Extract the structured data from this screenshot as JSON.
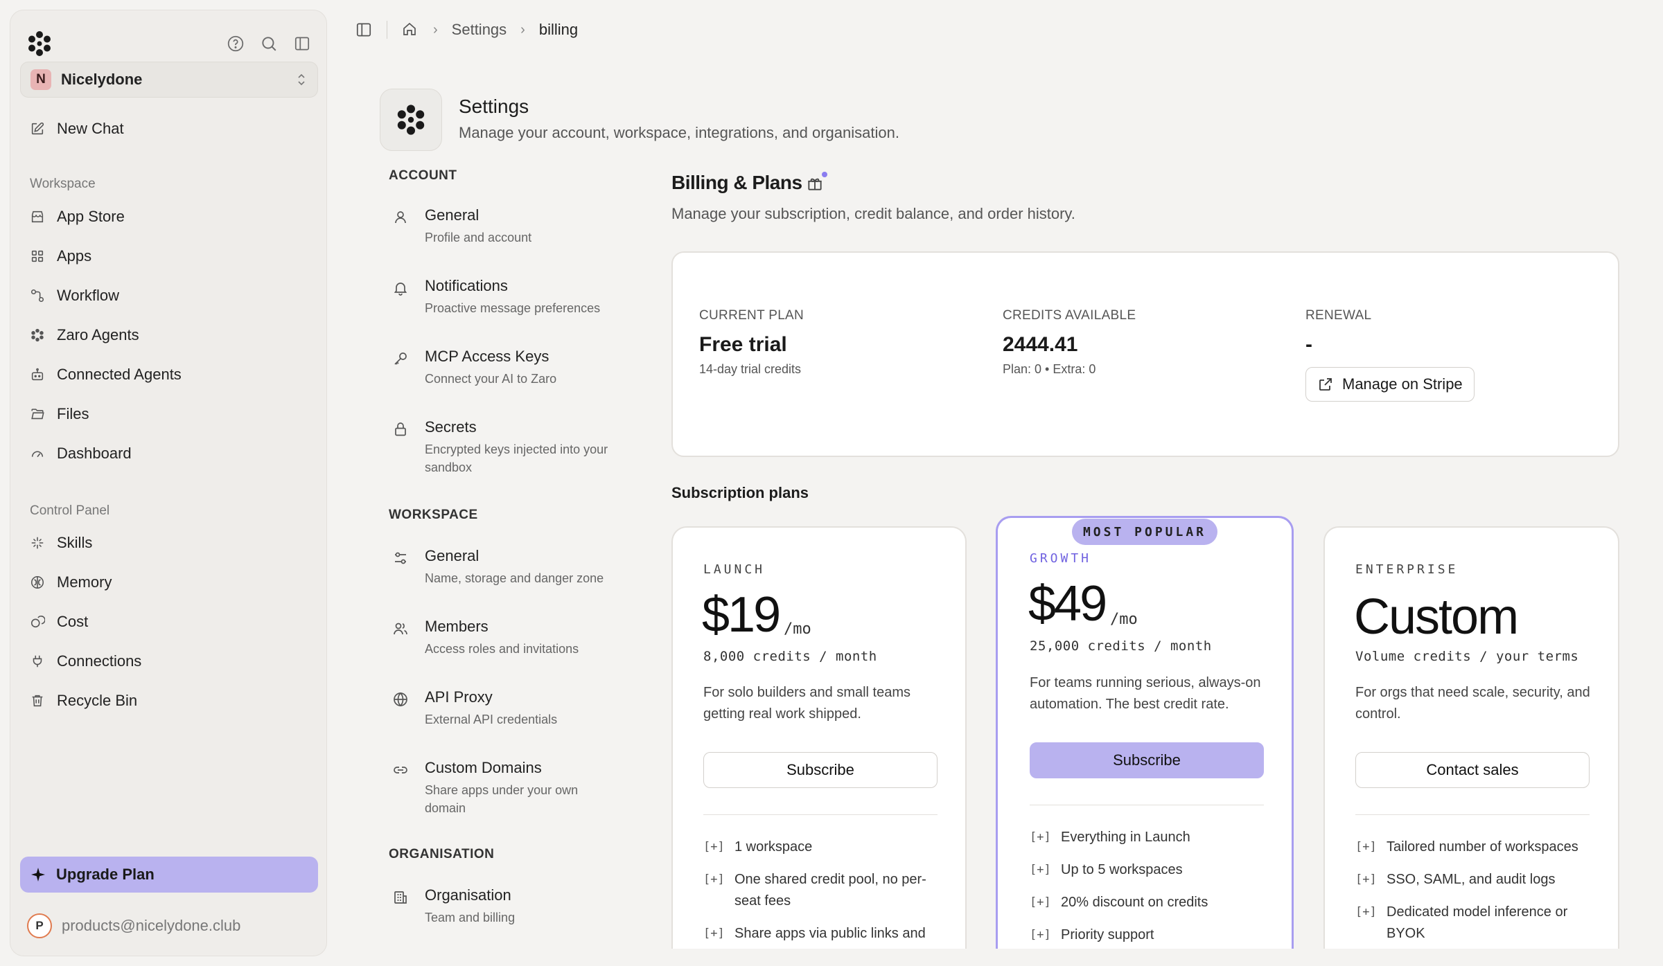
{
  "sidebar": {
    "workspace_badge": "N",
    "workspace_name": "Nicelydone",
    "new_chat": "New Chat",
    "section_workspace": "Workspace",
    "workspace_items": [
      {
        "label": "App Store",
        "icon": "store-icon"
      },
      {
        "label": "Apps",
        "icon": "apps-grid-icon"
      },
      {
        "label": "Workflow",
        "icon": "workflow-icon"
      },
      {
        "label": "Zaro Agents",
        "icon": "flower-icon"
      },
      {
        "label": "Connected Agents",
        "icon": "bot-icon"
      },
      {
        "label": "Files",
        "icon": "folder-icon"
      },
      {
        "label": "Dashboard",
        "icon": "gauge-icon"
      }
    ],
    "section_control": "Control Panel",
    "control_items": [
      {
        "label": "Skills",
        "icon": "sparkle-icon"
      },
      {
        "label": "Memory",
        "icon": "brain-icon"
      },
      {
        "label": "Cost",
        "icon": "coins-icon"
      },
      {
        "label": "Connections",
        "icon": "plug-icon"
      },
      {
        "label": "Recycle Bin",
        "icon": "trash-icon"
      }
    ],
    "upgrade_label": "Upgrade Plan",
    "user_initial": "P",
    "user_email": "products@nicelydone.club"
  },
  "breadcrumb": {
    "settings": "Settings",
    "current": "billing"
  },
  "settings": {
    "title": "Settings",
    "subtitle": "Manage your account, workspace, integrations, and organisation."
  },
  "nav": {
    "account_title": "ACCOUNT",
    "account": [
      {
        "title": "General",
        "desc": "Profile and account"
      },
      {
        "title": "Notifications",
        "desc": "Proactive message preferences"
      },
      {
        "title": "MCP Access Keys",
        "desc": "Connect your AI to Zaro"
      },
      {
        "title": "Secrets",
        "desc": "Encrypted keys injected into your sandbox"
      }
    ],
    "workspace_title": "WORKSPACE",
    "workspace": [
      {
        "title": "General",
        "desc": "Name, storage and danger zone"
      },
      {
        "title": "Members",
        "desc": "Access roles and invitations"
      },
      {
        "title": "API Proxy",
        "desc": "External API credentials"
      },
      {
        "title": "Custom Domains",
        "desc": "Share apps under your own domain"
      }
    ],
    "org_title": "ORGANISATION",
    "org": [
      {
        "title": "Organisation",
        "desc": "Team and billing"
      }
    ]
  },
  "billing": {
    "title": "Billing & Plans",
    "subtitle": "Manage your subscription, credit balance, and order history.",
    "current_plan_label": "CURRENT PLAN",
    "current_plan_value": "Free trial",
    "current_plan_note": "14-day trial credits",
    "credits_label": "CREDITS AVAILABLE",
    "credits_value": "2444.41",
    "credits_note": "Plan: 0 • Extra: 0",
    "renewal_label": "RENEWAL",
    "renewal_value": "-",
    "stripe_button": "Manage on Stripe",
    "plans_title": "Subscription plans",
    "popular_badge": "MOST POPULAR",
    "plans": [
      {
        "name": "LAUNCH",
        "price": "$19",
        "per": "/mo",
        "credits": "8,000 credits / month",
        "desc": "For solo builders and small teams getting real work shipped.",
        "button": "Subscribe",
        "features": [
          "1 workspace",
          "One shared credit pool, no per-seat fees",
          "Share apps via public links and"
        ]
      },
      {
        "name": "GROWTH",
        "price": "$49",
        "per": "/mo",
        "credits": "25,000 credits / month",
        "desc": "For teams running serious, always-on automation. The best credit rate.",
        "button": "Subscribe",
        "features": [
          "Everything in Launch",
          "Up to 5 workspaces",
          "20% discount on credits",
          "Priority support"
        ]
      },
      {
        "name": "ENTERPRISE",
        "price": "Custom",
        "per": "",
        "credits": "Volume credits / your terms",
        "desc": "For orgs that need scale, security, and control.",
        "button": "Contact sales",
        "features": [
          "Tailored number of workspaces",
          "SSO, SAML, and audit logs",
          "Dedicated model inference or BYOK"
        ]
      }
    ],
    "feature_bullet": "[+]"
  },
  "colors": {
    "accent": "#b9b2ef",
    "accent_text": "#7062e0",
    "background": "#f4f3f1"
  }
}
